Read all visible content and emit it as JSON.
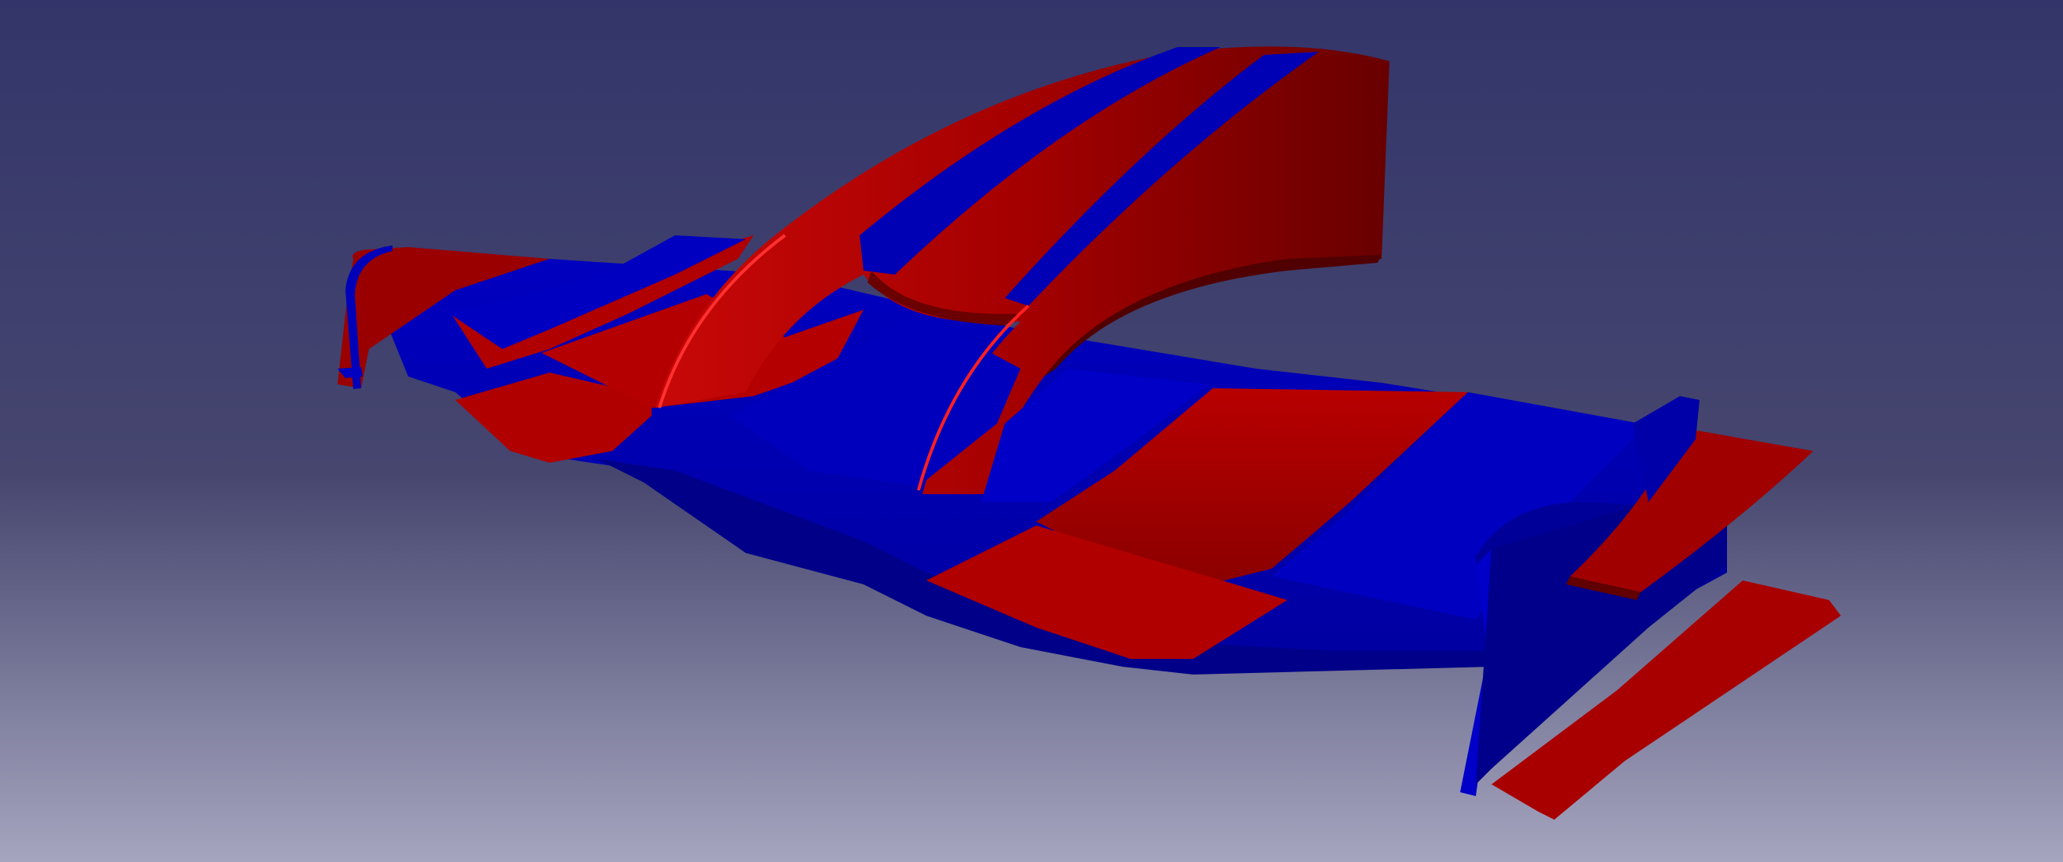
{
  "viewport": {
    "background_top": "#33356a",
    "background_mid": "#46466f",
    "background_bottom": "#a5a5bf"
  },
  "model": {
    "colors": {
      "red": "#b00000",
      "red_light": "#d81818",
      "red_dark": "#6a0000",
      "blue": "#0000b8",
      "blue_light": "#1818d8",
      "blue_dark": "#000070"
    }
  }
}
